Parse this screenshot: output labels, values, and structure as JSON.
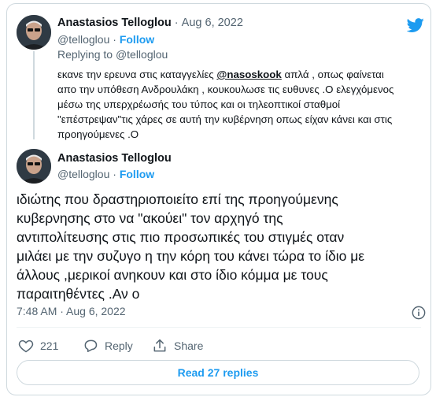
{
  "tweet1": {
    "author_name": "Anastasios Telloglou",
    "separator": "·",
    "date": "Aug 6, 2022",
    "handle": "@telloglou",
    "follow_label": "Follow",
    "replying_prefix": "Replying to",
    "replying_handle": "@telloglou",
    "line1_pre": "εκανε την ερευνα στις καταγγελίες ",
    "mention": "@nasoskook",
    "line1_post": " απλά , οπως φαίνεται",
    "line2": "απο την υπόθεση Ανδρουλάκη , κουκουλωσε τις ευθυνες .Ο ελεγχόμενος",
    "line3": "μέσω της υπερχρέωσής του τύπος και οι τηλεοπτικοί σταθμοί",
    "line4": "\"επέστρεψαν\"τις χάρες σε αυτή την κυβέρνηση οπως είχαν κάνει και στις",
    "line5": "προηγούμενες .Ο"
  },
  "tweet2": {
    "author_name": "Anastasios Telloglou",
    "handle": "@telloglou",
    "follow_label": "Follow",
    "line1": "ιδιώτης που δραστηριοποιείτο επί της προηγούμενης",
    "line2": "κυβερνησης στο να \"ακούει\" τον αρχηγό της",
    "line3": "αντιπολίτευσης στις πιο προσωπικές του στιγμές οταν",
    "line4": "μιλάει με την συζυγο η την κόρη του κάνει τώρα το ίδιο με",
    "line5": "άλλους ,μερικοί ανηκουν και στο ίδιο κόμμα με τους",
    "line6": "παραιτηθέντες .Αν ο",
    "timestamp": "7:48 AM · Aug 6, 2022"
  },
  "actions": {
    "like_count": "221",
    "reply_label": "Reply",
    "share_label": "Share"
  },
  "read_replies_label": "Read 27 replies",
  "colors": {
    "accent": "#1d9bf0",
    "muted": "#536471",
    "like": "#f91880"
  },
  "icons": [
    "twitter-bird-icon",
    "info-icon",
    "heart-icon",
    "reply-icon",
    "share-icon"
  ]
}
